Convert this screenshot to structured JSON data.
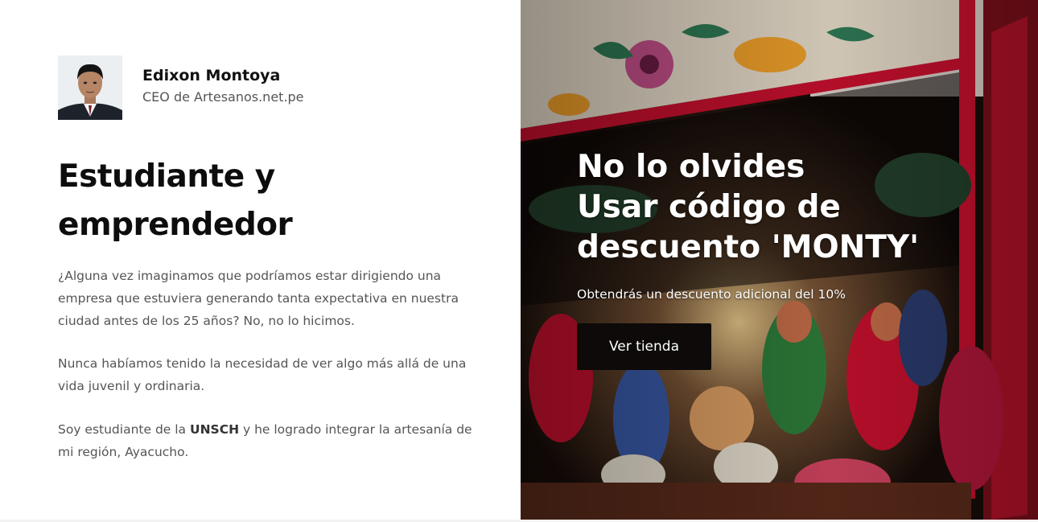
{
  "author": {
    "name": "Edixon Montoya",
    "role": "CEO de Artesanos.net.pe"
  },
  "headline": "Estudiante y emprendedor",
  "paragraphs": {
    "p1": "¿Alguna vez imaginamos que podríamos estar dirigiendo una empresa que estuviera generando tanta expectativa en nuestra ciudad antes de los 25 años? No, no lo hicimos.",
    "p2": "Nunca habíamos tenido la necesidad de ver algo más allá de una vida juvenil y ordinaria.",
    "p3_before": "Soy estudiante de la ",
    "p3_bold": "UNSCH",
    "p3_after": " y he logrado integrar la artesanía de mi región, Ayacucho."
  },
  "promo": {
    "line1": "No lo olvides",
    "line2": "Usar código de",
    "line3": "descuento 'MONTY'",
    "subtitle": "Obtendrás un descuento adicional del 10%",
    "button_label": "Ver tienda"
  },
  "colors": {
    "button_bg": "#0d0a09",
    "headline": "#0d0d0d",
    "body_text": "#555555",
    "retablo_red": "#c8102e"
  }
}
